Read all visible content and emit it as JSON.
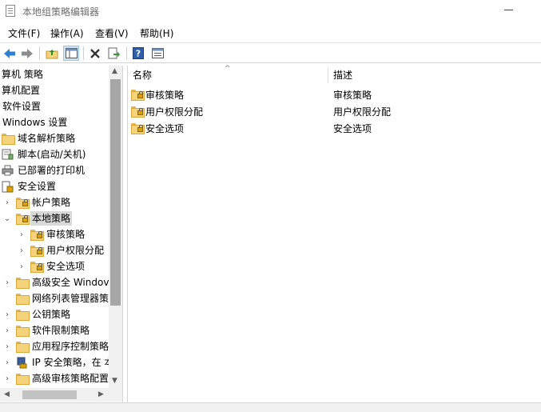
{
  "window": {
    "title": "本地组策略编辑器"
  },
  "menu": [
    {
      "key": "file",
      "label": "文件(F)"
    },
    {
      "key": "action",
      "label": "操作(A)"
    },
    {
      "key": "view",
      "label": "查看(V)"
    },
    {
      "key": "help",
      "label": "帮助(H)"
    }
  ],
  "toolbar": {
    "icons": [
      "back-arrow-icon",
      "forward-arrow-icon",
      "up-folder-icon",
      "show-hide-tree-icon",
      "delete-icon",
      "export-list-icon",
      "help-icon",
      "properties-icon"
    ]
  },
  "tree": {
    "items": [
      {
        "label": "算机 策略"
      },
      {
        "label": "算机配置"
      },
      {
        "label": "软件设置"
      },
      {
        "label": "Windows 设置"
      },
      {
        "label": "域名解析策略"
      },
      {
        "label": "脚本(启动/关机)"
      },
      {
        "label": "已部署的打印机"
      },
      {
        "label": "安全设置"
      },
      {
        "label": "帐户策略"
      },
      {
        "label": "本地策略"
      },
      {
        "label": "审核策略"
      },
      {
        "label": "用户权限分配"
      },
      {
        "label": "安全选项"
      },
      {
        "label": "高级安全 Windov"
      },
      {
        "label": "网络列表管理器策"
      },
      {
        "label": "公钥策略"
      },
      {
        "label": "软件限制策略"
      },
      {
        "label": "应用程序控制策略"
      },
      {
        "label": "IP 安全策略，在 本"
      },
      {
        "label": "高级审核策略配置"
      }
    ]
  },
  "list": {
    "columns": {
      "name": "名称",
      "desc": "描述"
    },
    "rows": [
      {
        "name": "审核策略",
        "desc": "审核策略"
      },
      {
        "name": "用户权限分配",
        "desc": "用户权限分配"
      },
      {
        "name": "安全选项",
        "desc": "安全选项"
      }
    ]
  },
  "colors": {
    "accent": "#cce4f7",
    "folder": "#f5d37a",
    "selection": "#d9d9d9"
  }
}
